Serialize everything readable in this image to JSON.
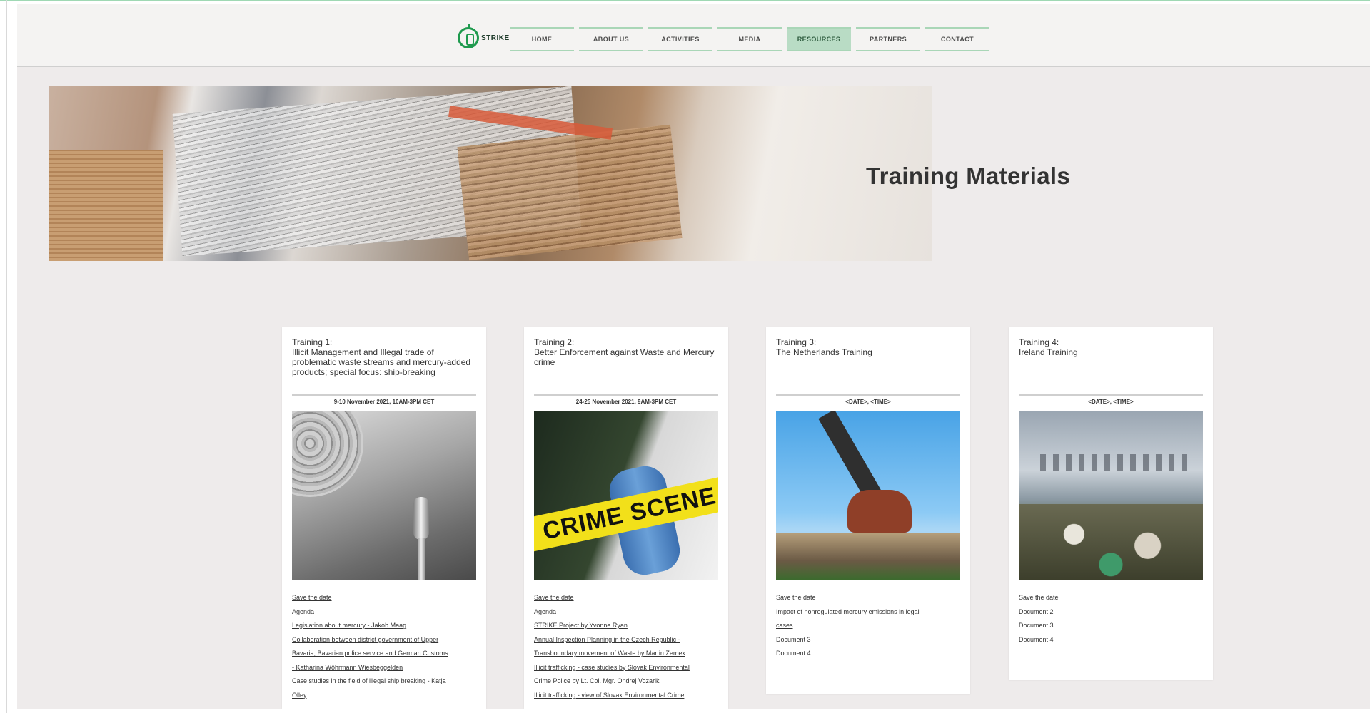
{
  "header": {
    "logo_text": "STRIKE",
    "nav": [
      {
        "label": "HOME",
        "active": false
      },
      {
        "label": "ABOUT US",
        "active": false
      },
      {
        "label": "ACTIVITIES",
        "active": false
      },
      {
        "label": "MEDIA",
        "active": false
      },
      {
        "label": "RESOURCES",
        "active": true
      },
      {
        "label": "PARTNERS",
        "active": false
      },
      {
        "label": "CONTACT",
        "active": false
      }
    ]
  },
  "hero": {
    "title": "Training Materials"
  },
  "cards": [
    {
      "title": "Training 1:",
      "subtitle": "Illicit Management and Illegal trade of problematic waste streams and mercury-added products; special focus: ship-breaking",
      "date": "9-10 November 2021, 10AM-3PM CET",
      "links": [
        "Save the date",
        "Agenda",
        "Legislation about mercury - Jakob Maag",
        "Collaboration between district government of Upper",
        "Bavaria, Bavarian police service and German Customs",
        "- Katharina Wöhrmann Wiesbeggelden",
        "Case studies in the field of illegal ship breaking - Katja",
        "Olley"
      ]
    },
    {
      "title": "Training 2:",
      "subtitle": "Better Enforcement against Waste and Mercury crime",
      "date": "24-25 November 2021, 9AM-3PM CET",
      "links": [
        "Save the date",
        "Agenda",
        "STRIKE Project by Yvonne Ryan",
        "Annual Inspection Planning in the Czech Republic -",
        "Transboundary movement of Waste by Martin Zemek",
        "Illicit trafficking - case studies by Slovak Environmental",
        "Crime Police by Lt. Col. Mgr. Ondrej Vozarik",
        "Illicit trafficking - view of Slovak Environmental Crime"
      ]
    },
    {
      "title": "Training 3:",
      "subtitle": "The Netherlands Training",
      "date": "<DATE>, <TIME>",
      "links": [
        "Save the date",
        "Impact of nonregulated mercury emissions in legal",
        "cases",
        "Document 3",
        "Document 4"
      ]
    },
    {
      "title": "Training 4:",
      "subtitle": "Ireland Training",
      "date": "<DATE>, <TIME>",
      "links": [
        "Save the date",
        "Document 2",
        "Document 3",
        "Document 4"
      ]
    }
  ]
}
